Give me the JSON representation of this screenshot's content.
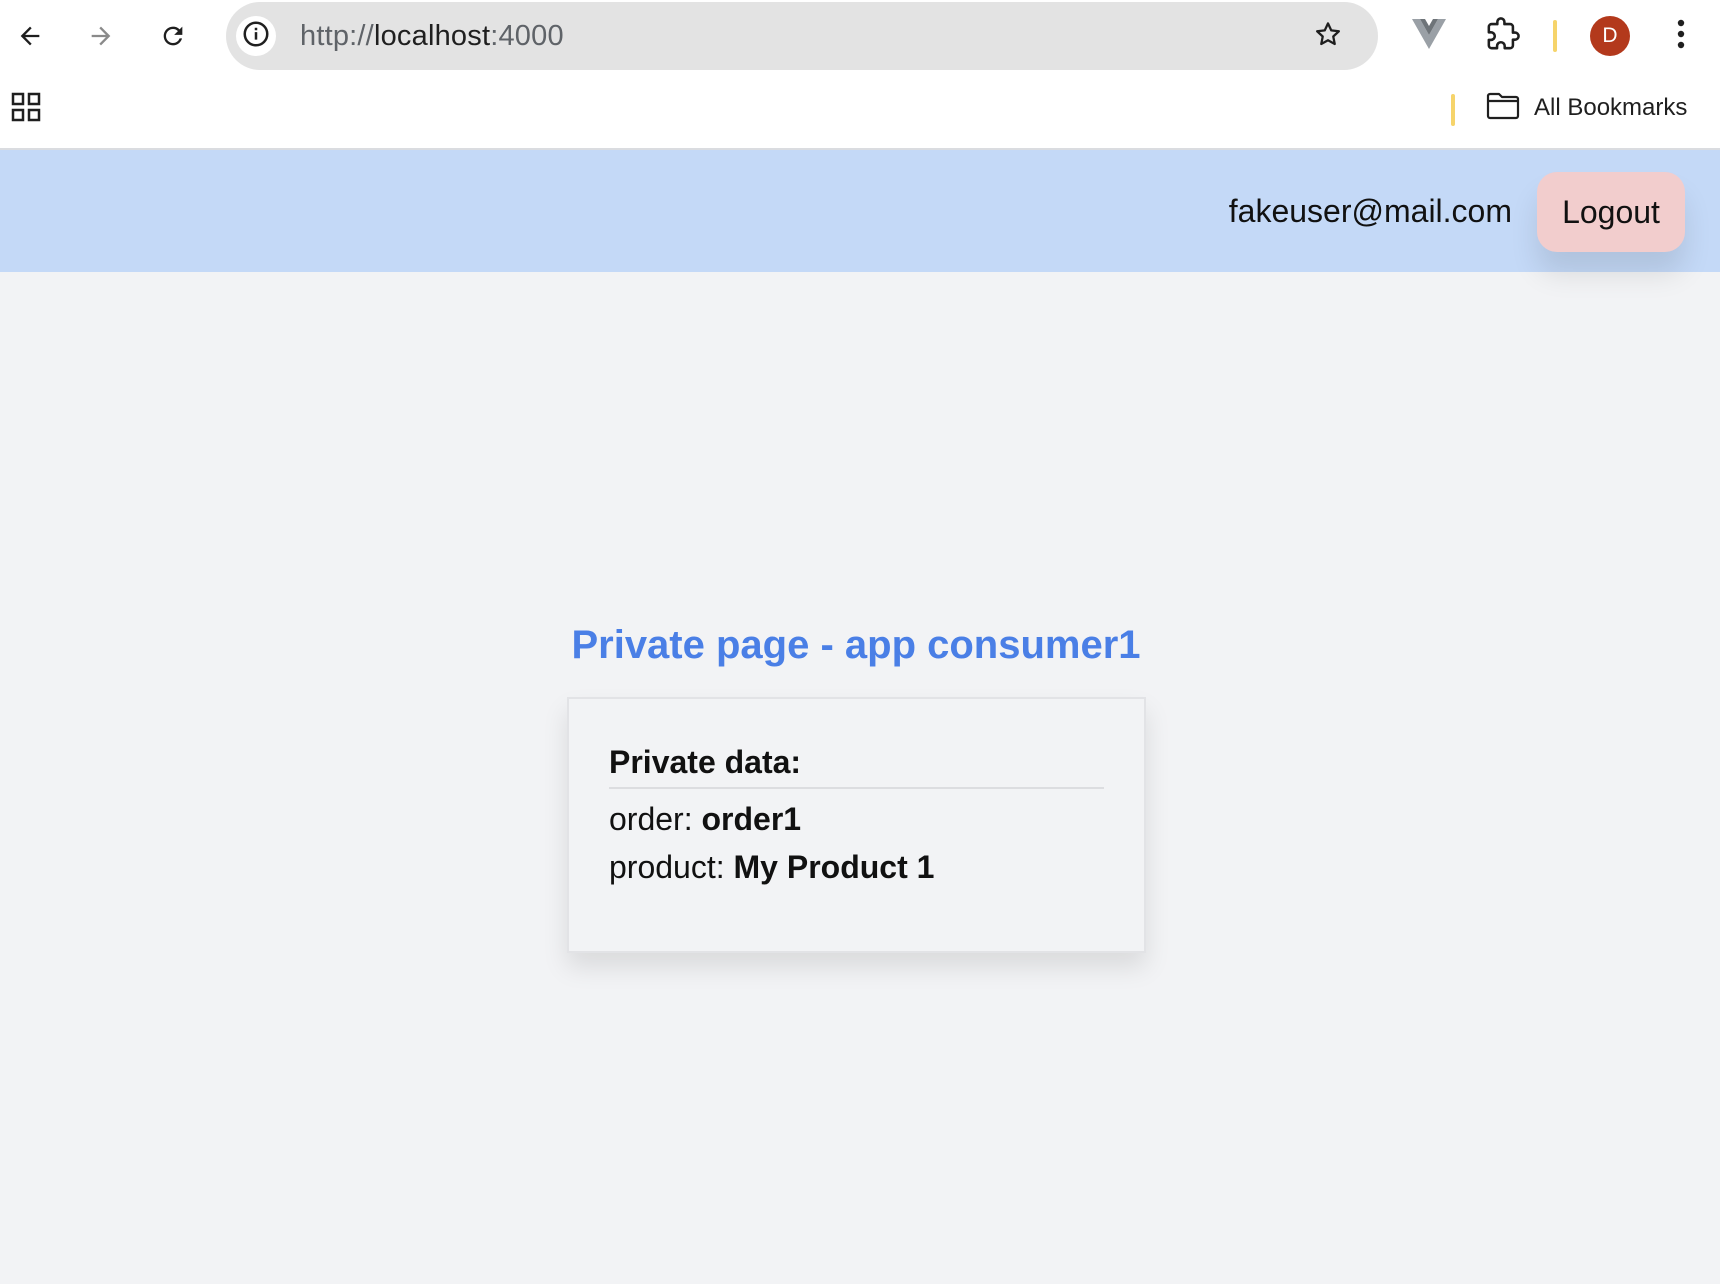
{
  "browser": {
    "url": {
      "scheme": "http://",
      "host": "localhost",
      "port": ":4000"
    },
    "avatar_letter": "D",
    "bookmarks_label": "All Bookmarks",
    "icons": [
      "back-icon",
      "forward-icon",
      "reload-icon",
      "site-info-icon",
      "star-icon",
      "vue-devtools-icon",
      "puzzle-icon",
      "more-vert-icon",
      "apps-grid-icon",
      "folder-icon"
    ],
    "accent_divider_color": "#f6d46b",
    "avatar_color": "#b3391c"
  },
  "header": {
    "user_email": "fakeuser@mail.com",
    "logout_label": "Logout",
    "background_color": "#c4d9f7",
    "logout_color": "#f2cdcd"
  },
  "main": {
    "title": "Private page - app consumer1",
    "title_color": "#4a7fe6",
    "card": {
      "heading": "Private data:",
      "rows": [
        {
          "label": "order: ",
          "value": "order1"
        },
        {
          "label": "product: ",
          "value": "My Product 1"
        }
      ]
    }
  }
}
